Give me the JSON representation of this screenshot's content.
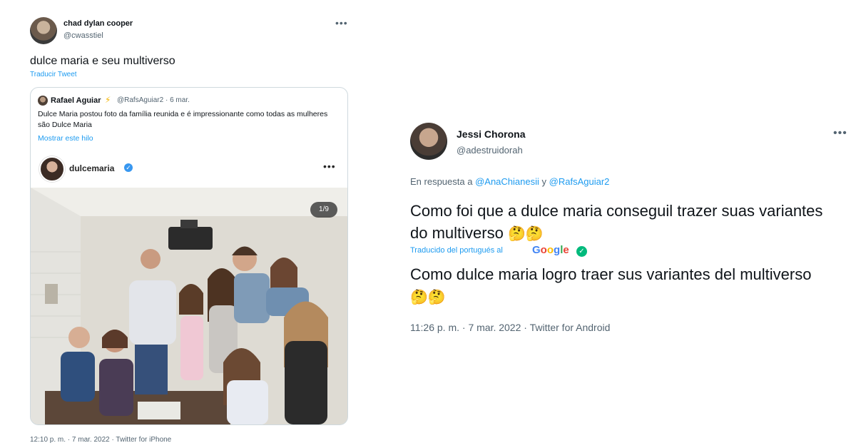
{
  "left_tweet": {
    "author_name": "chad dylan cooper",
    "author_handle": "@cwasstiel",
    "more_icon": "more-horizontal-icon",
    "text": "dulce maria e seu multiverso",
    "translate_link": "Traducir Tweet",
    "quoted": {
      "author_name": "Rafael Aguiar",
      "badge_icon": "lightning-bolt-icon",
      "handle_date": "@RafsAguiar2 · 6 mar.",
      "text": "Dulce Maria postou foto da família reunida e é impressionante como todas as mulheres são Dulce Maria",
      "show_thread": "Mostrar este hilo",
      "instagram": {
        "username": "dulcemaria",
        "verified_icon": "verified-badge-icon",
        "more_icon": "more-horizontal-icon",
        "photo_counter": "1/9"
      }
    },
    "footer": "12:10 p. m. · 7 mar. 2022 · Twitter for iPhone"
  },
  "right_tweet": {
    "author_name": "Jessi Chorona",
    "author_handle": "@adestruidorah",
    "more_icon": "more-horizontal-icon",
    "reply_prefix": "En respuesta a",
    "reply_mention_1": "@AnaChianesii",
    "reply_conjunction": "y",
    "reply_mention_2": "@RafsAguiar2",
    "text": "Como foi que a dulce maria conseguil trazer suas variantes do multiverso",
    "translated_from": "Traducido del portugués al",
    "google_logo": "Google",
    "google_check_icon": "checkmark-circle-icon",
    "translation": "Como dulce maria logro traer sus variantes del multiverso",
    "emoji_icon": "thinking-face-emoji",
    "footer": "11:26 p. m. · 7 mar. 2022 · Twitter for Android"
  },
  "colors": {
    "link_blue": "#1d9bf0",
    "secondary_text": "#536471",
    "primary_text": "#0f1419",
    "card_border": "#cfd9de",
    "google_check_green": "#00ba7c"
  }
}
